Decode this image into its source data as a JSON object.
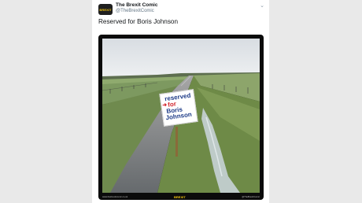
{
  "tweet": {
    "display_name": "The Brexit Comic",
    "handle": "@TheBrexitComic",
    "avatar_text": "BREXIT",
    "text": "Reserved for Boris Johnson",
    "menu_icon": "chevron-down-icon"
  },
  "image": {
    "sign_line1": "reserved",
    "sign_line2": "for",
    "sign_line3": "Boris",
    "sign_line4": "Johnson",
    "footer_left": "www.thebrexitcomic.co.uk",
    "footer_logo": "BREXIT",
    "footer_right": "@TheBrexitComic"
  },
  "colors": {
    "page_bg": "#e9e9e9",
    "card_bg": "#ffffff",
    "sign_red": "#d2232a",
    "sign_blue": "#1f3c88"
  }
}
